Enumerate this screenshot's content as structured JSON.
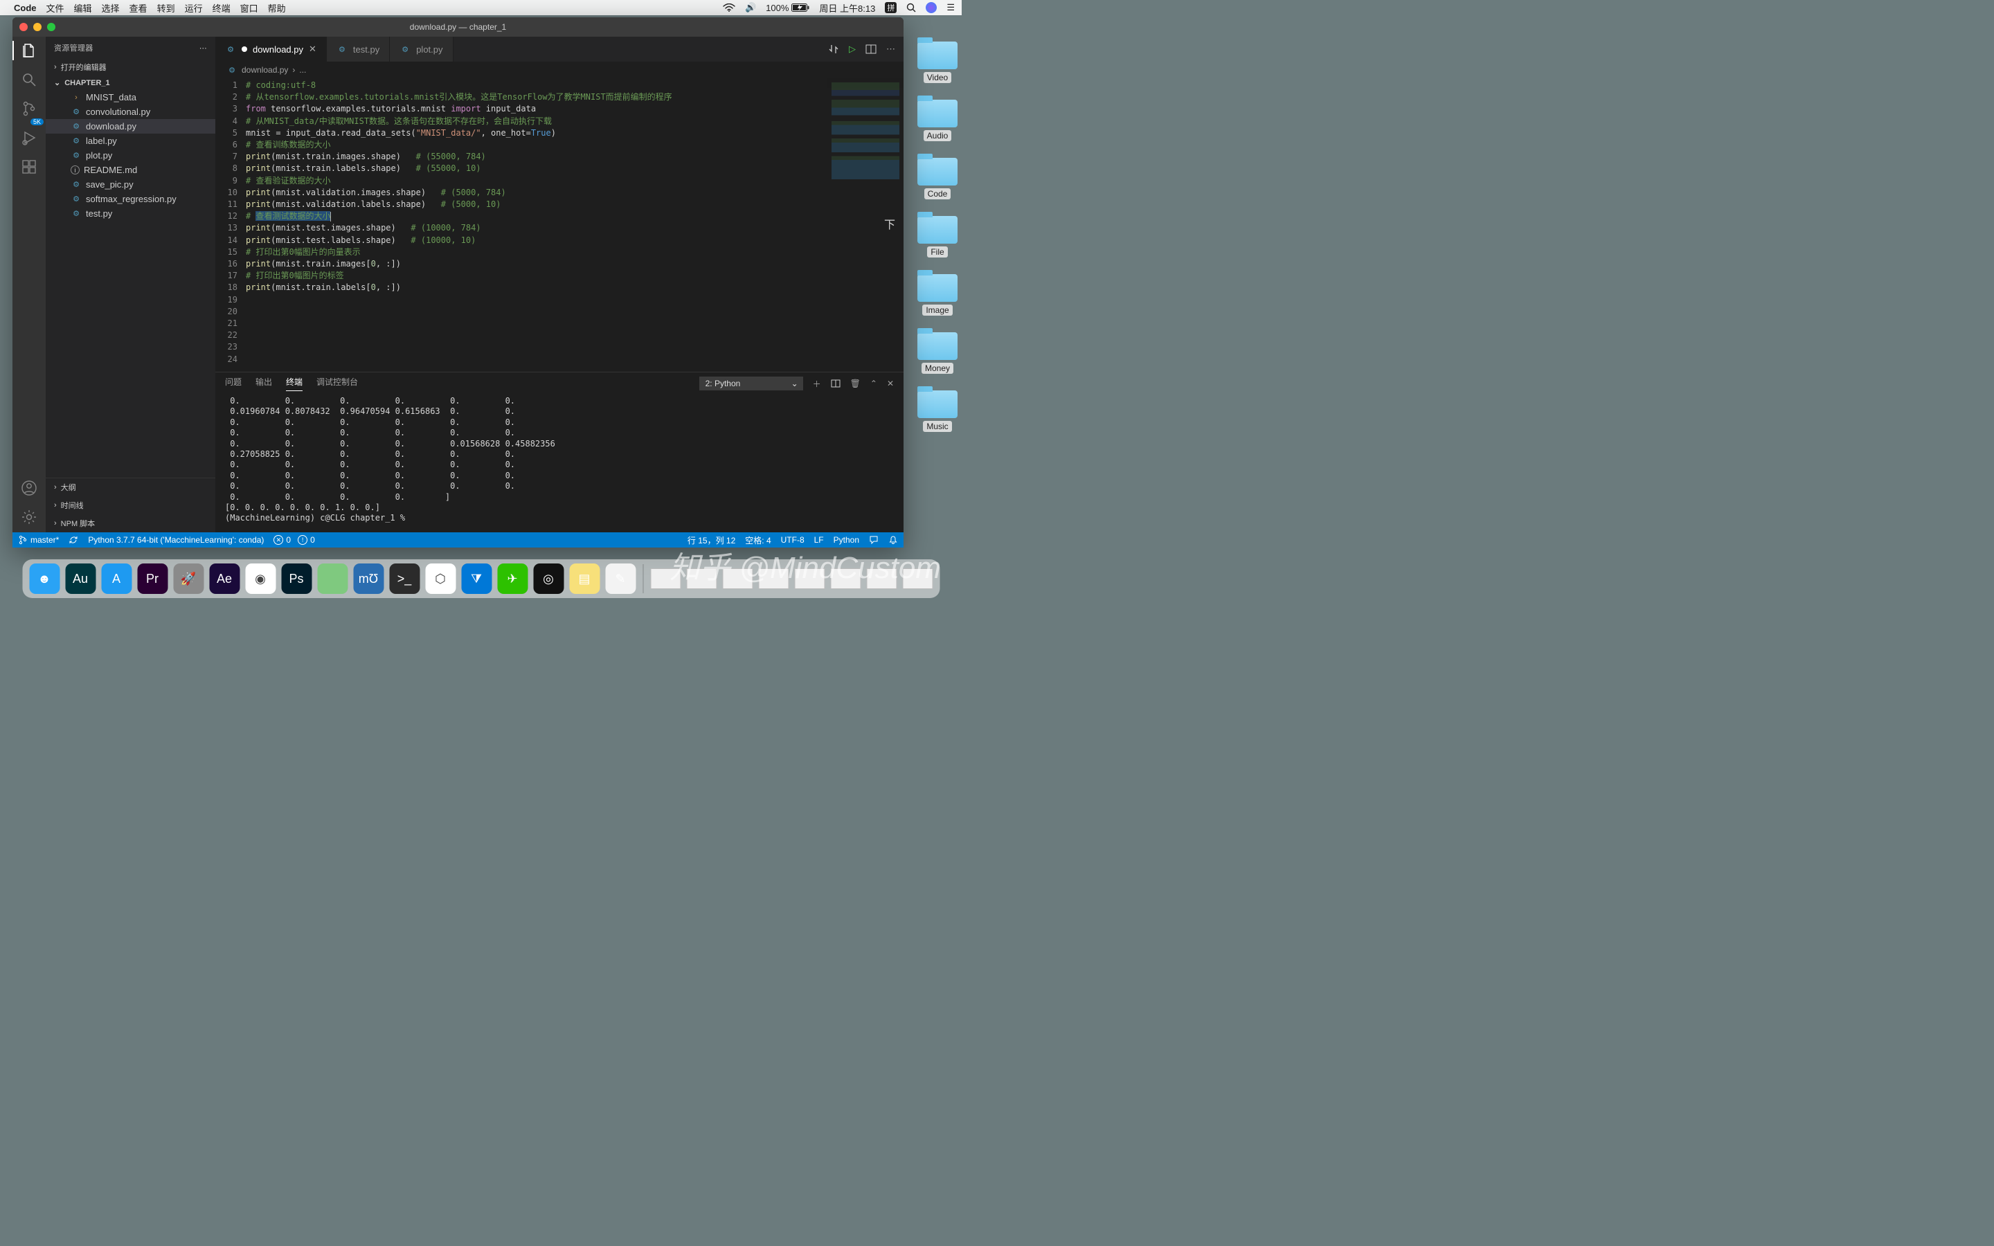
{
  "menubar": {
    "app_name": "Code",
    "items": [
      "文件",
      "编辑",
      "选择",
      "查看",
      "转到",
      "运行",
      "终端",
      "窗口",
      "帮助"
    ],
    "right": {
      "battery_pct": "100%",
      "date_time": "周日 上午8:13",
      "input_method": "拼"
    }
  },
  "window_title": "download.py — chapter_1",
  "sidebar": {
    "title": "资源管理器",
    "open_editors_label": "打开的编辑器",
    "root_name": "CHAPTER_1",
    "tree": [
      {
        "name": "MNIST_data",
        "type": "folder"
      },
      {
        "name": "convolutional.py",
        "type": "py"
      },
      {
        "name": "download.py",
        "type": "py",
        "selected": true
      },
      {
        "name": "label.py",
        "type": "py"
      },
      {
        "name": "plot.py",
        "type": "py"
      },
      {
        "name": "README.md",
        "type": "info"
      },
      {
        "name": "save_pic.py",
        "type": "py"
      },
      {
        "name": "softmax_regression.py",
        "type": "py"
      },
      {
        "name": "test.py",
        "type": "py"
      }
    ],
    "bottom_sections": [
      "大纲",
      "时间线",
      "NPM 脚本"
    ]
  },
  "activitybar_badge": "5K",
  "tabs": [
    {
      "label": "download.py",
      "active": true,
      "dirty": true
    },
    {
      "label": "test.py"
    },
    {
      "label": "plot.py"
    }
  ],
  "breadcrumb": [
    "download.py",
    "..."
  ],
  "code": {
    "lines": [
      {
        "n": 1,
        "segs": [
          [
            "c",
            "# coding:utf-8"
          ]
        ]
      },
      {
        "n": 2,
        "segs": [
          [
            "c",
            "# 从tensorflow.examples.tutorials.mnist引入模块。这是TensorFlow为了教学MNIST而提前编制的程序"
          ]
        ]
      },
      {
        "n": 3,
        "segs": [
          [
            "k",
            "from"
          ],
          [
            "",
            " tensorflow.examples.tutorials.mnist "
          ],
          [
            "k",
            "import"
          ],
          [
            "",
            " input_data"
          ]
        ]
      },
      {
        "n": 4,
        "segs": [
          [
            "c",
            "# 从MNIST_data/中读取MNIST数据。这条语句在数据不存在时，会自动执行下载"
          ]
        ]
      },
      {
        "n": 5,
        "segs": [
          [
            "",
            "mnist = input_data.read_data_sets("
          ],
          [
            "s",
            "\"MNIST_data/\""
          ],
          [
            "",
            ", one_hot="
          ],
          [
            "b",
            "True"
          ],
          [
            "",
            ")"
          ]
        ]
      },
      {
        "n": 6,
        "segs": []
      },
      {
        "n": 7,
        "segs": [
          [
            "c",
            "# 查看训练数据的大小"
          ]
        ]
      },
      {
        "n": 8,
        "segs": [
          [
            "f",
            "print"
          ],
          [
            "",
            "(mnist.train.images.shape)   "
          ],
          [
            "c",
            "# (55000, 784)"
          ]
        ]
      },
      {
        "n": 9,
        "segs": [
          [
            "f",
            "print"
          ],
          [
            "",
            "(mnist.train.labels.shape)   "
          ],
          [
            "c",
            "# (55000, 10)"
          ]
        ]
      },
      {
        "n": 10,
        "segs": []
      },
      {
        "n": 11,
        "segs": [
          [
            "c",
            "# 查看验证数据的大小"
          ]
        ]
      },
      {
        "n": 12,
        "segs": [
          [
            "f",
            "print"
          ],
          [
            "",
            "(mnist.validation.images.shape)   "
          ],
          [
            "c",
            "# (5000, 784)"
          ]
        ]
      },
      {
        "n": 13,
        "segs": [
          [
            "f",
            "print"
          ],
          [
            "",
            "(mnist.validation.labels.shape)   "
          ],
          [
            "c",
            "# (5000, 10)"
          ]
        ]
      },
      {
        "n": 14,
        "segs": []
      },
      {
        "n": 15,
        "segs": [
          [
            "c",
            "# "
          ],
          [
            "sel",
            "查看测试数据的大小"
          ]
        ],
        "cursor": true
      },
      {
        "n": 16,
        "segs": [
          [
            "f",
            "print"
          ],
          [
            "",
            "(mnist.test.images.shape)   "
          ],
          [
            "c",
            "# (10000, 784)"
          ]
        ]
      },
      {
        "n": 17,
        "segs": [
          [
            "f",
            "print"
          ],
          [
            "",
            "(mnist.test.labels.shape)   "
          ],
          [
            "c",
            "# (10000, 10)"
          ]
        ]
      },
      {
        "n": 18,
        "segs": []
      },
      {
        "n": 19,
        "segs": [
          [
            "c",
            "# 打印出第0幅图片的向量表示"
          ]
        ]
      },
      {
        "n": 20,
        "segs": [
          [
            "f",
            "print"
          ],
          [
            "",
            "(mnist.train.images["
          ],
          [
            "n",
            "0"
          ],
          [
            "",
            ", :])"
          ]
        ]
      },
      {
        "n": 21,
        "segs": []
      },
      {
        "n": 22,
        "segs": [
          [
            "c",
            "# 打印出第0幅图片的标签"
          ]
        ]
      },
      {
        "n": 23,
        "segs": [
          [
            "f",
            "print"
          ],
          [
            "",
            "(mnist.train.labels["
          ],
          [
            "n",
            "0"
          ],
          [
            "",
            ", :])"
          ]
        ]
      },
      {
        "n": 24,
        "segs": []
      }
    ]
  },
  "panel": {
    "tabs": [
      "问题",
      "输出",
      "终端",
      "调试控制台"
    ],
    "active_tab": "终端",
    "terminal_selector": "2: Python",
    "output": " 0.         0.         0.         0.         0.         0.\n 0.01960784 0.8078432  0.96470594 0.6156863  0.         0.\n 0.         0.         0.         0.         0.         0.\n 0.         0.         0.         0.         0.         0.\n 0.         0.         0.         0.         0.01568628 0.45882356\n 0.27058825 0.         0.         0.         0.         0.\n 0.         0.         0.         0.         0.         0.\n 0.         0.         0.         0.         0.         0.\n 0.         0.         0.         0.         0.         0.\n 0.         0.         0.         0.        ]\n[0. 0. 0. 0. 0. 0. 0. 1. 0. 0.]\n(MacchineLearning) c@CLG chapter_1 % "
  },
  "statusbar": {
    "branch": "master*",
    "python": "Python 3.7.7 64-bit ('MacchineLearning': conda)",
    "errors": "0",
    "warnings": "0",
    "cursor": "行 15，列 12",
    "spaces": "空格: 4",
    "encoding": "UTF-8",
    "eol": "LF",
    "language": "Python"
  },
  "desktop_folders": [
    "Video",
    "Audio",
    "Code",
    "File",
    "Image",
    "Money",
    "Music"
  ],
  "dock": {
    "apps": [
      {
        "name": "finder",
        "bg": "#2aa3f5",
        "glyph": "☻"
      },
      {
        "name": "audition",
        "bg": "#00373f",
        "glyph": "Au"
      },
      {
        "name": "appstore",
        "bg": "#1e9af1",
        "glyph": "A"
      },
      {
        "name": "premiere",
        "bg": "#2a0033",
        "glyph": "Pr"
      },
      {
        "name": "launchpad",
        "bg": "#8a8a8a",
        "glyph": "🚀"
      },
      {
        "name": "aftereffects",
        "bg": "#1a0a3a",
        "glyph": "Ae"
      },
      {
        "name": "chrome",
        "bg": "#ffffff",
        "glyph": "◉"
      },
      {
        "name": "photoshop",
        "bg": "#001d2b",
        "glyph": "Ps"
      },
      {
        "name": "green-circle",
        "bg": "#7fc97f",
        "glyph": ""
      },
      {
        "name": "musescore",
        "bg": "#2a6db0",
        "glyph": "mƱ"
      },
      {
        "name": "terminal",
        "bg": "#2b2b2b",
        "glyph": ">_"
      },
      {
        "name": "hex-yellow",
        "bg": "#ffffff",
        "glyph": "⬡"
      },
      {
        "name": "vscode",
        "bg": "#0078d7",
        "glyph": "⧩"
      },
      {
        "name": "wechat",
        "bg": "#2dc100",
        "glyph": "✈"
      },
      {
        "name": "ollama",
        "bg": "#111",
        "glyph": "◎"
      },
      {
        "name": "notes",
        "bg": "#f7e07a",
        "glyph": "▤"
      },
      {
        "name": "textedit",
        "bg": "#f3f3f3",
        "glyph": "✎"
      }
    ],
    "minimized": 8
  },
  "watermark": "知乎 @MindCustom"
}
